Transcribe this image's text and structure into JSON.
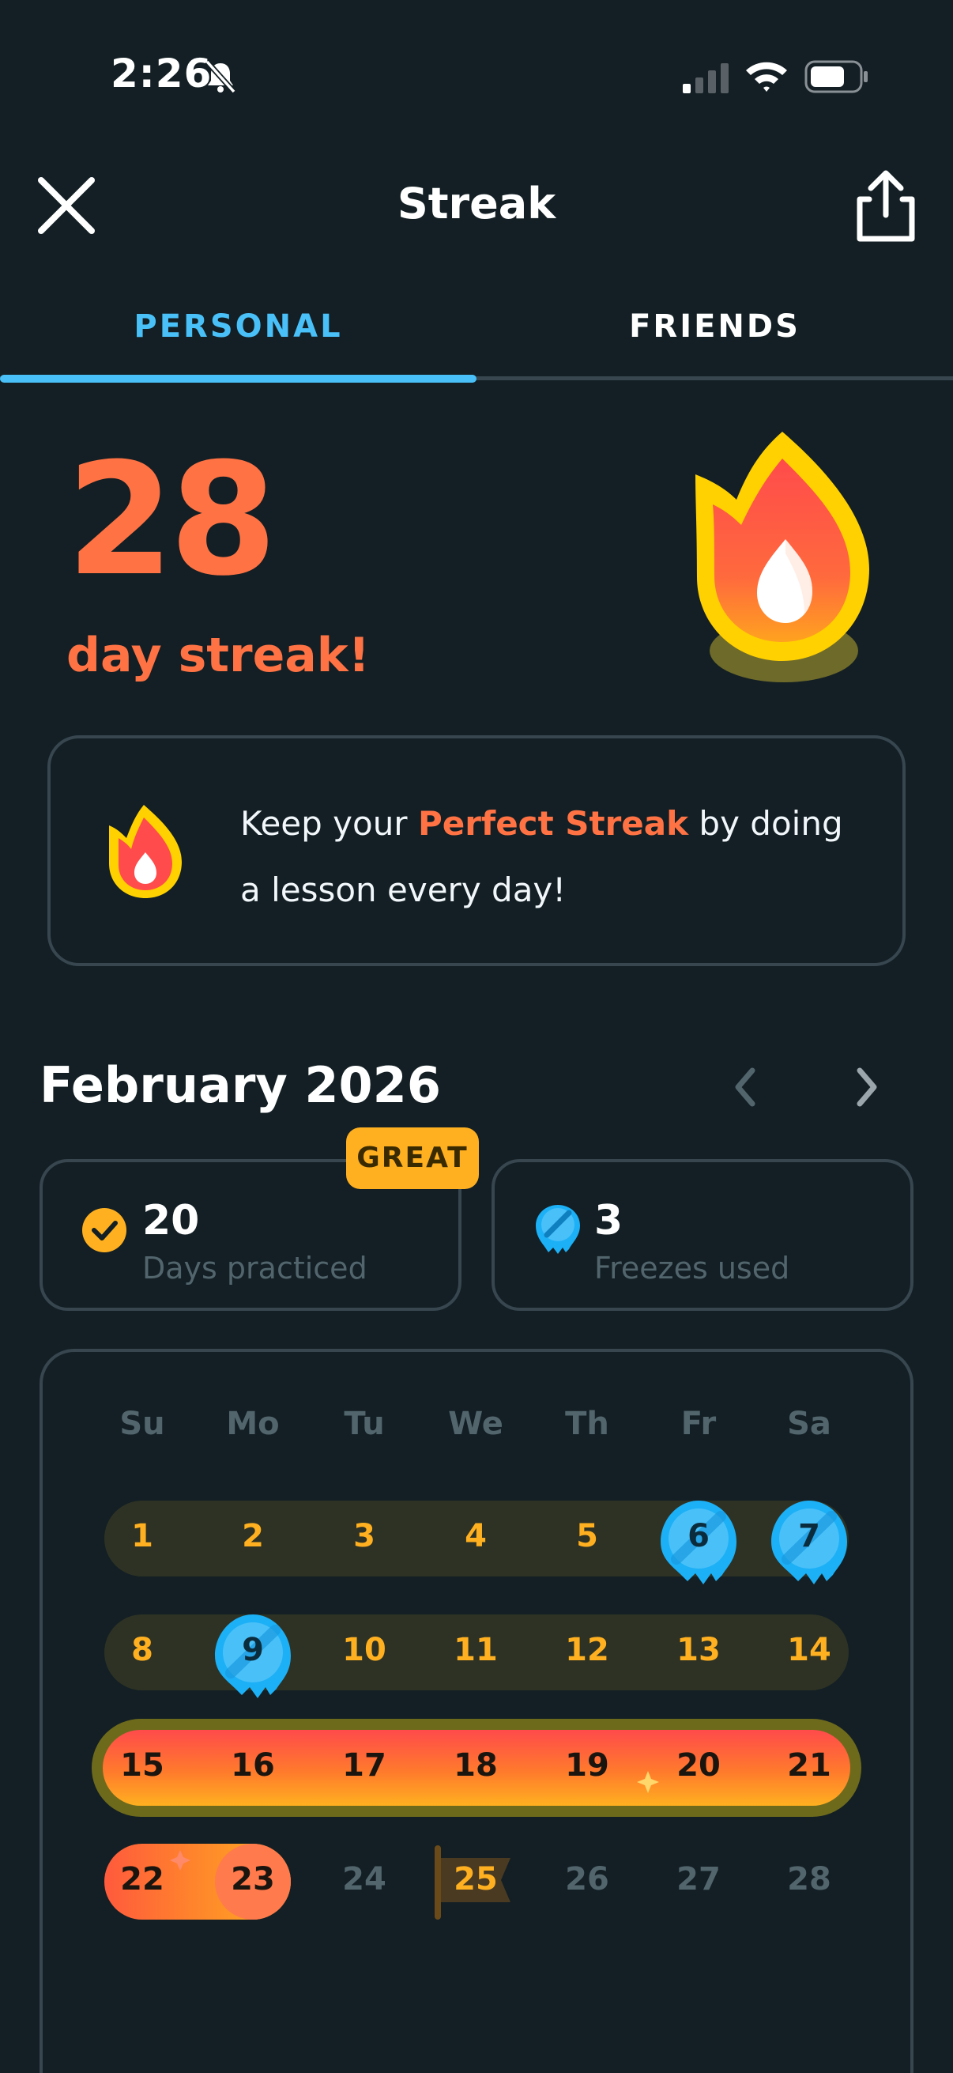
{
  "status_bar": {
    "time": "2:26",
    "icons": [
      "bell-slash-icon",
      "cellular-signal-icon",
      "wifi-icon",
      "battery-icon"
    ]
  },
  "header": {
    "title": "Streak",
    "close_icon": "close-icon",
    "share_icon": "share-icon"
  },
  "tabs": [
    {
      "label": "PERSONAL",
      "active": true
    },
    {
      "label": "FRIENDS",
      "active": false
    }
  ],
  "streak": {
    "count": "28",
    "label": "day streak!"
  },
  "info_card": {
    "text_before": "Keep your ",
    "highlight": "Perfect Streak",
    "text_after": " by doing a lesson every day!"
  },
  "calendar": {
    "month": "February 2026",
    "badge": "GREAT",
    "stats": {
      "days_practiced_value": "20",
      "days_practiced_label": "Days practiced",
      "freezes_value": "3",
      "freezes_label": "Freezes used"
    },
    "weekdays": [
      "Su",
      "Mo",
      "Tu",
      "We",
      "Th",
      "Fr",
      "Sa"
    ],
    "weeks": [
      [
        {
          "d": "1",
          "s": "practiced"
        },
        {
          "d": "2",
          "s": "practiced"
        },
        {
          "d": "3",
          "s": "practiced"
        },
        {
          "d": "4",
          "s": "practiced"
        },
        {
          "d": "5",
          "s": "practiced"
        },
        {
          "d": "6",
          "s": "frozen"
        },
        {
          "d": "7",
          "s": "frozen"
        }
      ],
      [
        {
          "d": "8",
          "s": "practiced"
        },
        {
          "d": "9",
          "s": "frozen"
        },
        {
          "d": "10",
          "s": "practiced"
        },
        {
          "d": "11",
          "s": "practiced"
        },
        {
          "d": "12",
          "s": "practiced"
        },
        {
          "d": "13",
          "s": "practiced"
        },
        {
          "d": "14",
          "s": "practiced"
        }
      ],
      [
        {
          "d": "15",
          "s": "perfect"
        },
        {
          "d": "16",
          "s": "perfect"
        },
        {
          "d": "17",
          "s": "perfect"
        },
        {
          "d": "18",
          "s": "perfect"
        },
        {
          "d": "19",
          "s": "perfect"
        },
        {
          "d": "20",
          "s": "perfect"
        },
        {
          "d": "21",
          "s": "perfect"
        }
      ],
      [
        {
          "d": "22",
          "s": "perfect"
        },
        {
          "d": "23",
          "s": "perfect"
        },
        {
          "d": "24",
          "s": "future"
        },
        {
          "d": "25",
          "s": "today"
        },
        {
          "d": "26",
          "s": "future"
        },
        {
          "d": "27",
          "s": "future"
        },
        {
          "d": "28",
          "s": "future"
        }
      ]
    ]
  },
  "colors": {
    "background": "#131f24",
    "accent_blue": "#49c0f8",
    "streak_orange": "#ff7244",
    "practiced_gold": "#ffb020",
    "border": "#37464f",
    "muted_text": "#52656d"
  }
}
